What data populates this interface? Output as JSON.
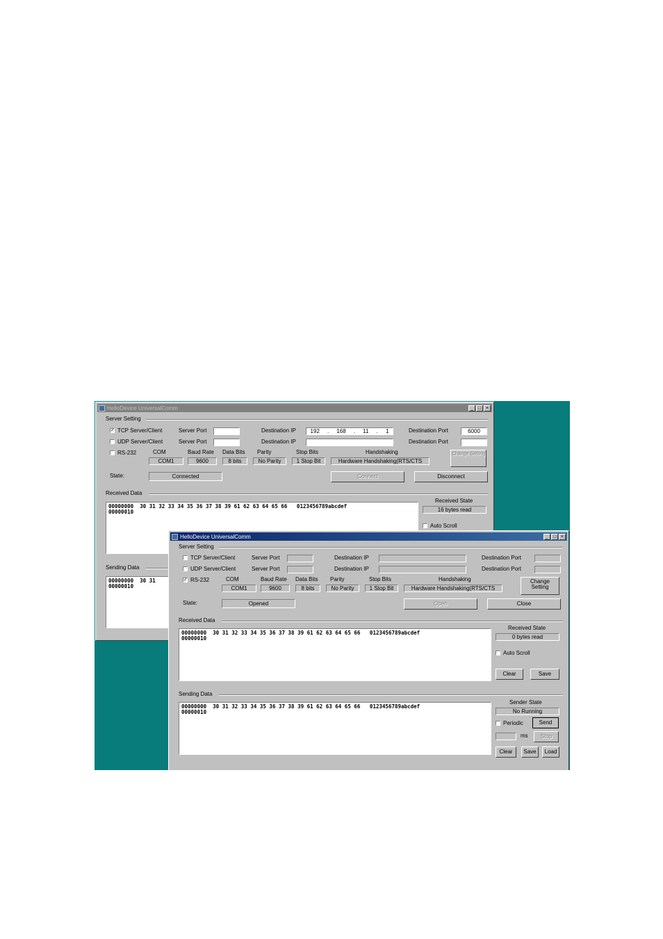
{
  "back_window": {
    "title": "HelloDevice UniversalComm",
    "server_setting": "Server Setting",
    "tcp_label": "TCP Server/Client",
    "tcp_checked": "✓",
    "udp_label": "UDP Server/Client",
    "udp_checked": "",
    "rs232_label": "RS-232",
    "rs232_checked": "",
    "server_port_label": "Server Port",
    "dest_ip_label": "Destination IP",
    "dest_port_label": "Destination Port",
    "tcp_server_port": "",
    "tcp_dest_ip": [
      "192",
      "168",
      "11",
      "1"
    ],
    "tcp_dest_port": "6000",
    "udp_server_port": "",
    "udp_dest_ip": "",
    "udp_dest_port": "",
    "com_label": "COM",
    "baud_label": "Baud Rate",
    "databits_label": "Data Bits",
    "parity_label": "Parity",
    "stopbits_label": "Stop Bits",
    "handshaking_label": "Handshaking",
    "com_value": "COM1",
    "baud_value": "9600",
    "databits_value": "8 bits",
    "parity_value": "No Parity",
    "stopbits_value": "1 Stop Bit",
    "handshaking_value": "Hardware Handshaking(RTS/CTS",
    "change_setting": "Change Setting",
    "state_label": "State:",
    "state_value": "Connected",
    "connect_button": "Connect",
    "disconnect_button": "Disconnect",
    "received_data_label": "Received Data",
    "received_line1": "00000000  30 31 32 33 34 35 36 37 38 39 61 62 63 64 65 66   0123456789abcdef",
    "received_line2": "00000010",
    "received_state_label": "Received State",
    "received_state_value": "16 bytes read",
    "auto_scroll": "Auto Scroll",
    "sending_data_label": "Sending Data",
    "sending_line1": "00000000  30 31",
    "sending_line2": "00000010"
  },
  "front_window": {
    "title": "HelloDevice UniversalComm",
    "server_setting": "Server Setting",
    "tcp_label": "TCP Server/Client",
    "tcp_checked": "",
    "udp_label": "UDP Server/Client",
    "udp_checked": "",
    "rs232_label": "RS-232",
    "rs232_checked": "✓",
    "server_port_label": "Server Port",
    "dest_ip_label": "Destination IP",
    "dest_port_label": "Destination Port",
    "com_label": "COM",
    "baud_label": "Baud Rate",
    "databits_label": "Data Bits",
    "parity_label": "Parity",
    "stopbits_label": "Stop Bits",
    "handshaking_label": "Handshaking",
    "com_value": "COM1",
    "baud_value": "9600",
    "databits_value": "8 bits",
    "parity_value": "No Parity",
    "stopbits_value": "1 Stop Bit",
    "handshaking_value": "Hardware Handshaking(RTS/CTS",
    "change_setting_line1": "Change",
    "change_setting_line2": "Setting",
    "state_label": "State:",
    "state_value": "Opened",
    "open_button": "Open",
    "close_button": "Close",
    "received_data_label": "Received Data",
    "received_line1": "00000000  30 31 32 33 34 35 36 37 38 39 61 62 63 64 65 66   0123456789abcdef",
    "received_line2": "00000010",
    "received_state_label": "Received State",
    "received_state_value": "0 bytes read",
    "auto_scroll": "Auto Scroll",
    "clear_button": "Clear",
    "save_button": "Save",
    "sending_data_label": "Sending Data",
    "sending_line1": "00000000  30 31 32 33 34 35 36 37 38 39 61 62 63 64 65 66   0123456789abcdef",
    "sending_line2": "00000010",
    "sender_state_label": "Sender State",
    "sender_state_value": "No Running",
    "periodic_label": "Periodic",
    "send_button": "Send",
    "interval_value": "",
    "ms_label": "ms",
    "stop_button": "Stop",
    "send_clear_button": "Clear",
    "send_save_button": "Save",
    "load_button": "Load"
  },
  "title_buttons": {
    "minimize": "_",
    "maximize": "□",
    "close": "×"
  },
  "colors": {
    "desktop": "#087b7b",
    "window": "#c0c0c0",
    "active_title": "#0a246a",
    "inactive_title": "#808080"
  }
}
